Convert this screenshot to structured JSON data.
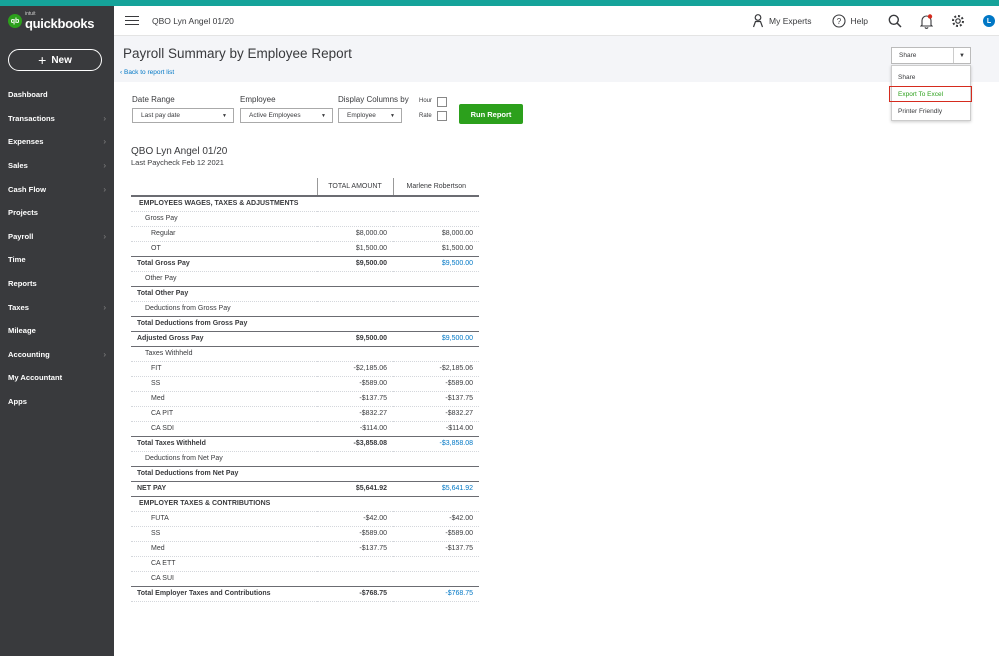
{
  "brand": {
    "small": "intuit",
    "name": "quickbooks",
    "accent": "#2ca01c",
    "sidebar_bg": "#393a3d"
  },
  "sidebar": {
    "new_label": "New",
    "items": [
      {
        "label": "Dashboard",
        "chevron": false
      },
      {
        "label": "Transactions",
        "chevron": true
      },
      {
        "label": "Expenses",
        "chevron": true
      },
      {
        "label": "Sales",
        "chevron": true
      },
      {
        "label": "Cash Flow",
        "chevron": true
      },
      {
        "label": "Projects",
        "chevron": false
      },
      {
        "label": "Payroll",
        "chevron": true
      },
      {
        "label": "Time",
        "chevron": false
      },
      {
        "label": "Reports",
        "chevron": false
      },
      {
        "label": "Taxes",
        "chevron": true
      },
      {
        "label": "Mileage",
        "chevron": false
      },
      {
        "label": "Accounting",
        "chevron": true
      },
      {
        "label": "My Accountant",
        "chevron": false
      },
      {
        "label": "Apps",
        "chevron": false
      }
    ]
  },
  "topbar": {
    "company": "QBO Lyn Angel 01/20",
    "my_experts": "My Experts",
    "help": "Help",
    "avatar": "L"
  },
  "header": {
    "title": "Payroll Summary by Employee Report",
    "back": "Back to report list",
    "share_label": "Share",
    "dropdown": [
      "Share",
      "Export To Excel",
      "Printer Friendly"
    ]
  },
  "filters": {
    "date_range_label": "Date Range",
    "date_range_value": "Last pay date",
    "employee_label": "Employee",
    "employee_value": "Active Employees",
    "display_label": "Display Columns by",
    "display_value": "Employee",
    "hour_label": "Hour",
    "rate_label": "Rate",
    "run_label": "Run Report"
  },
  "report": {
    "company": "QBO Lyn Angel 01/20",
    "subtitle": "Last Paycheck Feb 12 2021",
    "columns": [
      "",
      "TOTAL AMOUNT",
      "Marlene Robertson"
    ],
    "rows": [
      {
        "label": "EMPLOYEES WAGES, TAXES & ADJUSTMENTS",
        "total": "",
        "emp": "",
        "type": "sec"
      },
      {
        "label": "Gross Pay",
        "total": "",
        "emp": "",
        "type": "l1"
      },
      {
        "label": "Regular",
        "total": "$8,000.00",
        "emp": "$8,000.00",
        "type": "l2"
      },
      {
        "label": "OT",
        "total": "$1,500.00",
        "emp": "$1,500.00",
        "type": "l2"
      },
      {
        "label": "Total Gross Pay",
        "total": "$9,500.00",
        "emp": "$9,500.00",
        "type": "total"
      },
      {
        "label": "Other Pay",
        "total": "",
        "emp": "",
        "type": "l1"
      },
      {
        "label": "Total Other Pay",
        "total": "",
        "emp": "",
        "type": "total"
      },
      {
        "label": "Deductions from Gross Pay",
        "total": "",
        "emp": "",
        "type": "l1"
      },
      {
        "label": "Total Deductions from Gross Pay",
        "total": "",
        "emp": "",
        "type": "total"
      },
      {
        "label": "Adjusted Gross Pay",
        "total": "$9,500.00",
        "emp": "$9,500.00",
        "type": "grand"
      },
      {
        "label": "Taxes Withheld",
        "total": "",
        "emp": "",
        "type": "l1"
      },
      {
        "label": "FIT",
        "total": "-$2,185.06",
        "emp": "-$2,185.06",
        "type": "l2"
      },
      {
        "label": "SS",
        "total": "-$589.00",
        "emp": "-$589.00",
        "type": "l2"
      },
      {
        "label": "Med",
        "total": "-$137.75",
        "emp": "-$137.75",
        "type": "l2"
      },
      {
        "label": "CA PIT",
        "total": "-$832.27",
        "emp": "-$832.27",
        "type": "l2"
      },
      {
        "label": "CA SDI",
        "total": "-$114.00",
        "emp": "-$114.00",
        "type": "l2"
      },
      {
        "label": "Total Taxes Withheld",
        "total": "-$3,858.08",
        "emp": "-$3,858.08",
        "type": "total"
      },
      {
        "label": "Deductions from Net Pay",
        "total": "",
        "emp": "",
        "type": "l1"
      },
      {
        "label": "Total Deductions from Net Pay",
        "total": "",
        "emp": "",
        "type": "total"
      },
      {
        "label": "NET PAY",
        "total": "$5,641.92",
        "emp": "$5,641.92",
        "type": "grand"
      },
      {
        "label": "EMPLOYER TAXES & CONTRIBUTIONS",
        "total": "",
        "emp": "",
        "type": "sec"
      },
      {
        "label": "FUTA",
        "total": "-$42.00",
        "emp": "-$42.00",
        "type": "l2"
      },
      {
        "label": "SS",
        "total": "-$589.00",
        "emp": "-$589.00",
        "type": "l2"
      },
      {
        "label": "Med",
        "total": "-$137.75",
        "emp": "-$137.75",
        "type": "l2"
      },
      {
        "label": "CA ETT",
        "total": "",
        "emp": "",
        "type": "l2"
      },
      {
        "label": "CA SUI",
        "total": "",
        "emp": "",
        "type": "l2"
      },
      {
        "label": "Total Employer Taxes and Contributions",
        "total": "-$768.75",
        "emp": "-$768.75",
        "type": "total"
      }
    ]
  }
}
